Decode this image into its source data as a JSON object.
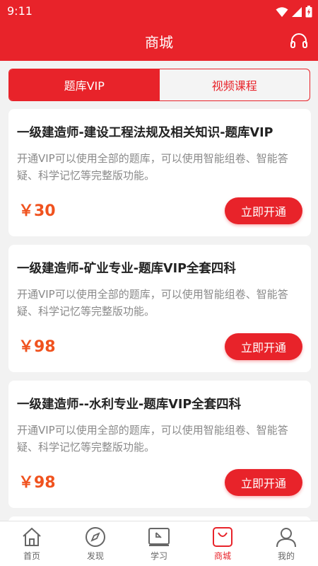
{
  "status_bar": {
    "time": "9:11"
  },
  "header": {
    "title": "商城"
  },
  "tabs": [
    {
      "label": "题库VIP",
      "active": true
    },
    {
      "label": "视频课程",
      "active": false
    }
  ],
  "products": [
    {
      "title": "一级建造师-建设工程法规及相关知识-题库VIP",
      "description": "开通VIP可以使用全部的题库，可以使用智能组卷、智能答疑、科学记忆等完整版功能。",
      "price": "￥30",
      "button": "立即开通"
    },
    {
      "title": "一级建造师-矿业专业-题库VIP全套四科",
      "description": "开通VIP可以使用全部的题库，可以使用智能组卷、智能答疑、科学记忆等完整版功能。",
      "price": "￥98",
      "button": "立即开通"
    },
    {
      "title": "一级建造师--水利专业-题库VIP全套四科",
      "description": "开通VIP可以使用全部的题库，可以使用智能组卷、智能答疑、科学记忆等完整版功能。",
      "price": "￥98",
      "button": "立即开通"
    }
  ],
  "bottom_nav": [
    {
      "label": "首页",
      "icon": "home-icon",
      "active": false
    },
    {
      "label": "发现",
      "icon": "compass-icon",
      "active": false
    },
    {
      "label": "学习",
      "icon": "study-icon",
      "active": false
    },
    {
      "label": "商城",
      "icon": "shopping-bag-icon",
      "active": true
    },
    {
      "label": "我的",
      "icon": "person-icon",
      "active": false
    }
  ],
  "colors": {
    "primary": "#e8232a",
    "price": "#f0521e",
    "background": "#f2f2f2"
  }
}
